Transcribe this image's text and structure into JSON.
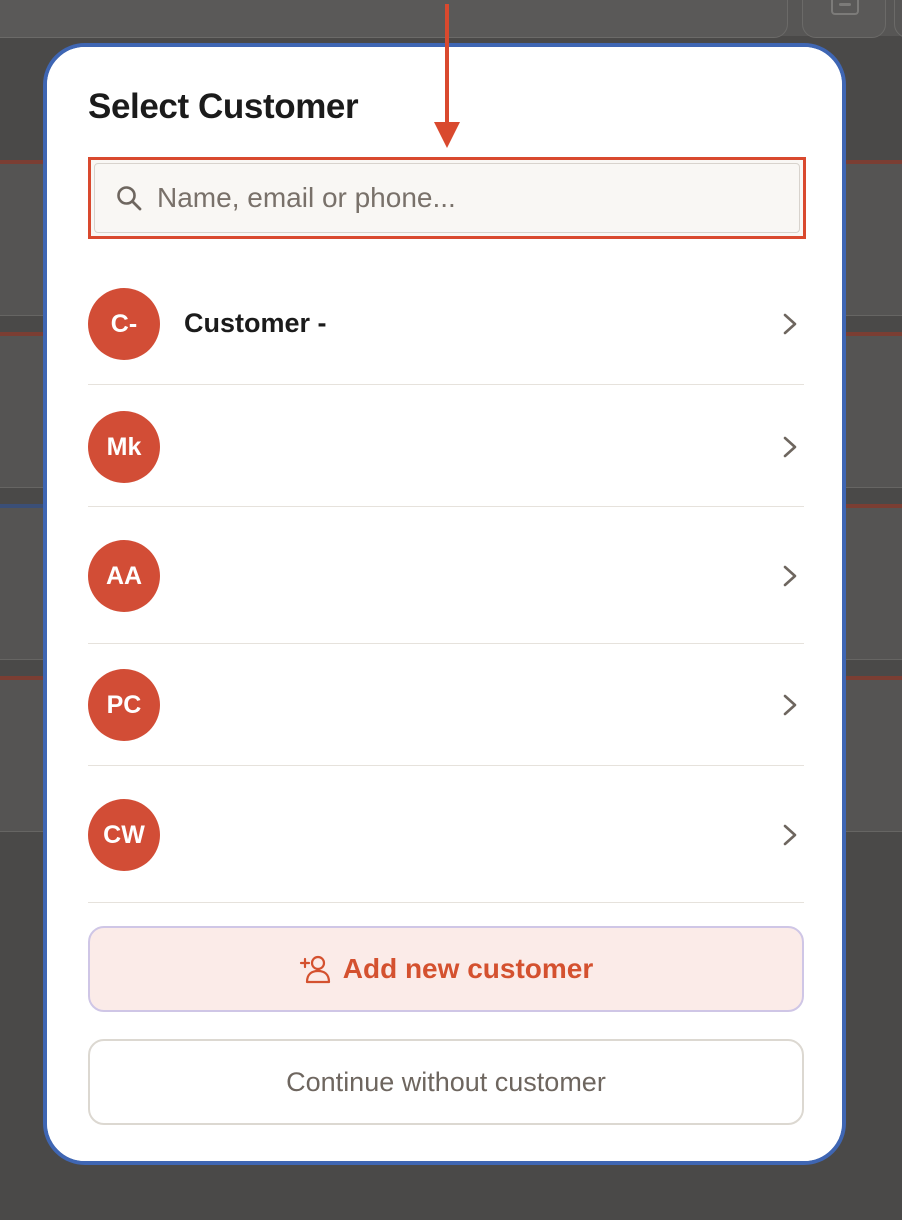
{
  "modal": {
    "title": "Select Customer",
    "search": {
      "placeholder": "Name, email or phone...",
      "value": ""
    },
    "customers": [
      {
        "initials": "C-",
        "name": "Customer -"
      },
      {
        "initials": "Mk",
        "name": ""
      },
      {
        "initials": "AA",
        "name": ""
      },
      {
        "initials": "PC",
        "name": ""
      },
      {
        "initials": "CW",
        "name": ""
      }
    ],
    "add_button_label": "Add new customer",
    "continue_button_label": "Continue without customer"
  },
  "icons": {
    "search": "search-icon",
    "chevron": "chevron-right-icon",
    "add_user": "add-user-icon",
    "tray": "tray-icon"
  },
  "colors": {
    "accent": "#d24d36",
    "annotation": "#d9492e",
    "modal_border": "#3f66b3",
    "add_button_bg": "#fbebe8",
    "overlay": "#4a4948"
  }
}
